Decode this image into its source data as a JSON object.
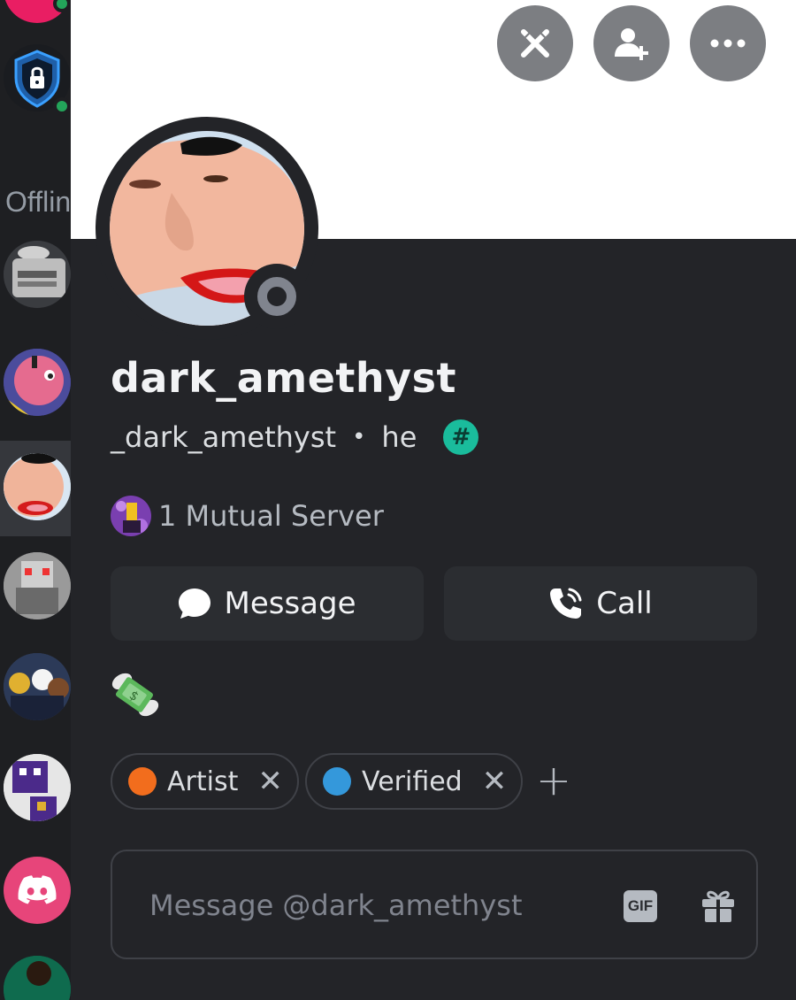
{
  "sidebar": {
    "offline_label": "Offline"
  },
  "profile": {
    "display_name": "dark_amethyst",
    "username": "_dark_amethyst",
    "separator": "•",
    "pronouns": "he",
    "badge_symbol": "#",
    "status": "offline",
    "mutual_servers": "1 Mutual Server",
    "bio_emoji": "money-with-wings"
  },
  "actions": {
    "message_label": "Message",
    "call_label": "Call"
  },
  "top_buttons": [
    "swords-icon",
    "add-friend-icon",
    "more-icon"
  ],
  "roles": [
    {
      "name": "Artist",
      "color": "#f26d1d",
      "remove_symbol": "✕"
    },
    {
      "name": "Verified",
      "color": "#3498db",
      "remove_symbol": "✕"
    }
  ],
  "add_role_symbol": "+",
  "composer": {
    "placeholder": "Message @dark_amethyst",
    "gif_label": "GIF"
  },
  "colors": {
    "background": "#1e1f22",
    "panel": "#232428",
    "banner": "#ffffff",
    "button": "#2b2d31",
    "online": "#23a55a",
    "offline": "#80848e",
    "badge": "#1abc9c"
  }
}
